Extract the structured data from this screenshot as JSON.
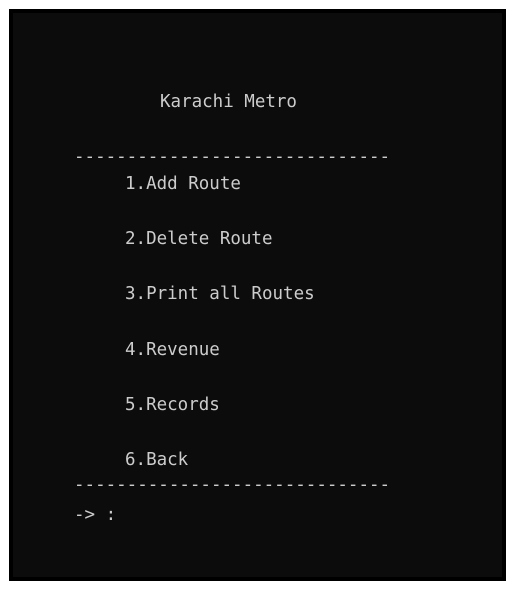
{
  "console": {
    "title": "Karachi Metro",
    "divider": "------------------------------",
    "menu": [
      {
        "label": "1.Add Route"
      },
      {
        "label": "2.Delete Route"
      },
      {
        "label": "3.Print all Routes"
      },
      {
        "label": "4.Revenue"
      },
      {
        "label": "5.Records"
      },
      {
        "label": "6.Back"
      }
    ],
    "prompt": "-> :"
  },
  "colors": {
    "background": "#0c0c0c",
    "text": "#cccccc"
  }
}
